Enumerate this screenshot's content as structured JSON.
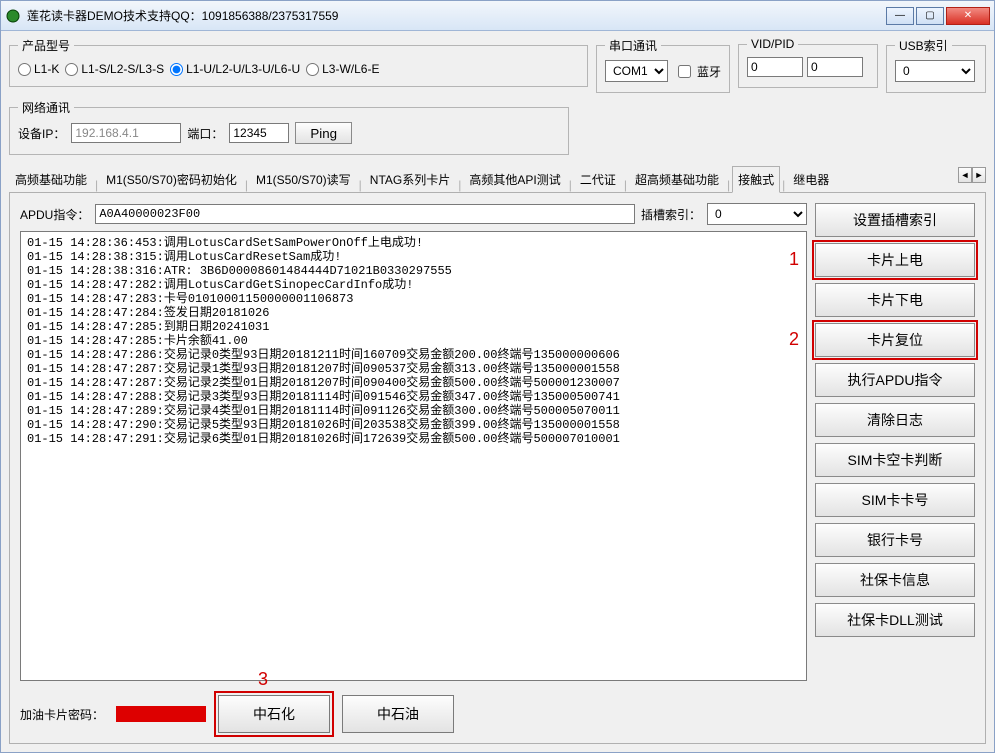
{
  "window": {
    "title": "莲花读卡器DEMO技术支持QQ：1091856388/2375317559"
  },
  "product": {
    "legend": "产品型号",
    "options": [
      "L1-K",
      "L1-S/L2-S/L3-S",
      "L1-U/L2-U/L3-U/L6-U",
      "L3-W/L6-E"
    ],
    "selected": 2
  },
  "serial": {
    "legend": "串口通讯",
    "port": "COM1",
    "bluetooth_label": "蓝牙"
  },
  "vidpid": {
    "legend": "VID/PID",
    "vid": "0",
    "pid": "0"
  },
  "usbidx": {
    "legend": "USB索引",
    "value": "0"
  },
  "network": {
    "legend": "网络通讯",
    "ip_label": "设备IP：",
    "ip": "192.168.4.1",
    "port_label": "端口：",
    "port": "12345",
    "ping": "Ping"
  },
  "tabs": {
    "items": [
      "高频基础功能",
      "M1(S50/S70)密码初始化",
      "M1(S50/S70)读写",
      "NTAG系列卡片",
      "高频其他API测试",
      "二代证",
      "超高频基础功能",
      "接触式",
      "继电器"
    ],
    "active": 7
  },
  "apdu": {
    "label": "APDU指令：",
    "value": "A0A40000023F00",
    "slot_label": "插槽索引：",
    "slot_value": "0"
  },
  "log_lines": [
    "01-15 14:28:36:453:调用LotusCardSetSamPowerOnOff上电成功!",
    "01-15 14:28:38:315:调用LotusCardResetSam成功!",
    "01-15 14:28:38:316:ATR: 3B6D00008601484444D71021B0330297555",
    "01-15 14:28:47:282:调用LotusCardGetSinopecCardInfo成功!",
    "01-15 14:28:47:283:卡号01010001150000001106873",
    "01-15 14:28:47:284:签发日期20181026",
    "01-15 14:28:47:285:到期日期20241031",
    "01-15 14:28:47:285:卡片余额41.00",
    "01-15 14:28:47:286:交易记录0类型93日期20181211时间160709交易金额200.00终端号135000000606",
    "01-15 14:28:47:287:交易记录1类型93日期20181207时间090537交易金额313.00终端号135000001558",
    "01-15 14:28:47:287:交易记录2类型01日期20181207时间090400交易金额500.00终端号500001230007",
    "01-15 14:28:47:288:交易记录3类型93日期20181114时间091546交易金额347.00终端号135000500741",
    "01-15 14:28:47:289:交易记录4类型01日期20181114时间091126交易金额300.00终端号500005070011",
    "01-15 14:28:47:290:交易记录5类型93日期20181026时间203538交易金额399.00终端号135000001558",
    "01-15 14:28:47:291:交易记录6类型01日期20181026时间172639交易金额500.00终端号500007010001"
  ],
  "bottom": {
    "label": "加油卡片密码：",
    "btn_sinopec": "中石化",
    "btn_petrochina": "中石油"
  },
  "right_buttons": [
    "设置插槽索引",
    "卡片上电",
    "卡片下电",
    "卡片复位",
    "执行APDU指令",
    "清除日志",
    "SIM卡空卡判断",
    "SIM卡卡号",
    "银行卡号",
    "社保卡信息",
    "社保卡DLL测试"
  ],
  "annotations": {
    "a1": "1",
    "a2": "2",
    "a3": "3"
  }
}
